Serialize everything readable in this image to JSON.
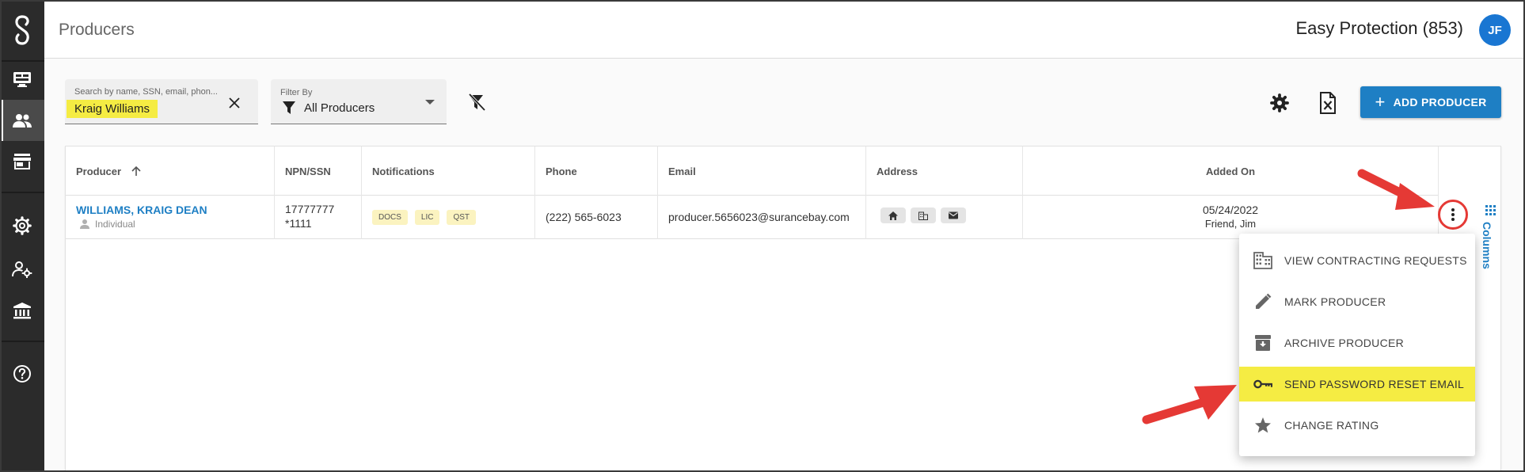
{
  "header": {
    "title": "Producers",
    "agency": "Easy Protection (853)",
    "avatar_initials": "JF"
  },
  "toolbar": {
    "search_label": "Search by name, SSN, email, phon...",
    "search_value": "Kraig Williams",
    "filter_label": "Filter By",
    "filter_value": "All Producers",
    "add_label": "ADD PRODUCER"
  },
  "table": {
    "columns": [
      "Producer",
      "NPN/SSN",
      "Notifications",
      "Phone",
      "Email",
      "Address",
      "Added On"
    ],
    "rows": [
      {
        "name": "WILLIAMS, KRAIG DEAN",
        "type": "Individual",
        "npn": "17777777",
        "ssn": "*1111",
        "badges": [
          "DOCS",
          "LIC",
          "QST"
        ],
        "phone": "(222) 565-6023",
        "email": "producer.5656023@surancebay.com",
        "added_date": "05/24/2022",
        "added_by": "Friend, Jim"
      }
    ]
  },
  "columns_tab": "Columns",
  "menu": {
    "items": [
      {
        "label": "VIEW CONTRACTING REQUESTS",
        "icon": "building-icon"
      },
      {
        "label": "MARK PRODUCER",
        "icon": "pencil-icon"
      },
      {
        "label": "ARCHIVE PRODUCER",
        "icon": "archive-icon"
      },
      {
        "label": "SEND PASSWORD RESET EMAIL",
        "icon": "key-icon"
      },
      {
        "label": "CHANGE RATING",
        "icon": "star-icon"
      }
    ]
  },
  "colors": {
    "accent": "#1e7fc4",
    "highlight": "#f5ec43",
    "sidebar": "#2b2b2b",
    "annotation": "#e53935"
  }
}
